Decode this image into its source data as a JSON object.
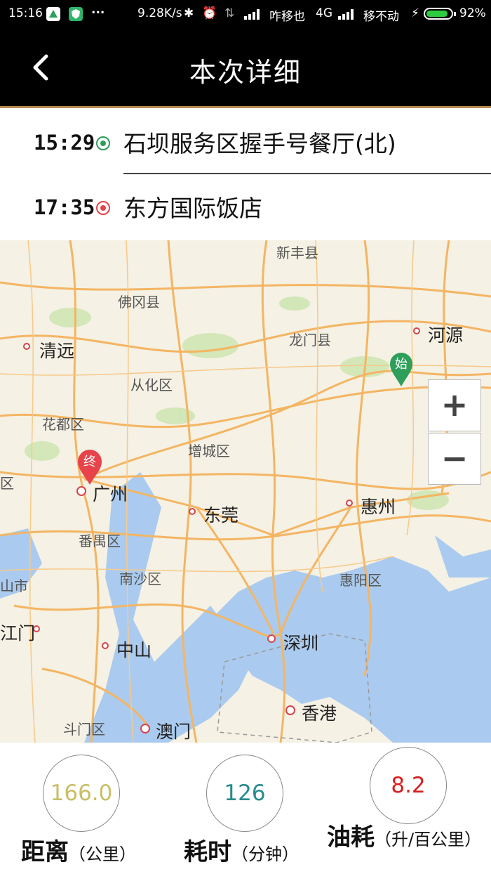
{
  "status_bar": {
    "time": "15:16",
    "dots": "...",
    "speed": "9.28K/s",
    "carrier1": "咋移也",
    "network": "4G",
    "carrier2": "移不动",
    "battery": "92%"
  },
  "header": {
    "title": "本次详细",
    "back_icon": "chevron-left-icon"
  },
  "trip": {
    "start": {
      "time": "15:29",
      "place": "石坝服务区握手号餐厅(北)",
      "color": "#2e9e5b"
    },
    "end": {
      "time": "17:35",
      "place": "东方国际饭店",
      "color": "#e8434a"
    }
  },
  "map": {
    "labels": [
      "新丰县",
      "佛冈县",
      "清远",
      "龙门县",
      "河源",
      "从化区",
      "花都区",
      "增城区",
      "区",
      "广州",
      "东莞",
      "惠州",
      "番禺区",
      "南沙区",
      "惠阳区",
      "山市",
      "江门",
      "中山",
      "深圳",
      "香港",
      "斗门区",
      "澳门"
    ],
    "start_marker": "始",
    "end_marker": "终",
    "zoom_in": "+",
    "zoom_out": "−",
    "colors": {
      "land": "#f5f1e4",
      "water": "#aacbef",
      "road": "#f4b563",
      "green": "#cfe6b4"
    }
  },
  "stats": {
    "distance": {
      "value": "166.0",
      "label": "距离",
      "unit": "（公里）",
      "color": "#c8bf66"
    },
    "duration": {
      "value": "126",
      "label": "耗时",
      "unit": "（分钟）",
      "color": "#2a8a8e"
    },
    "fuel": {
      "value": "8.2",
      "label": "油耗",
      "unit": "（升/百公里）",
      "color": "#d81e1e"
    }
  }
}
